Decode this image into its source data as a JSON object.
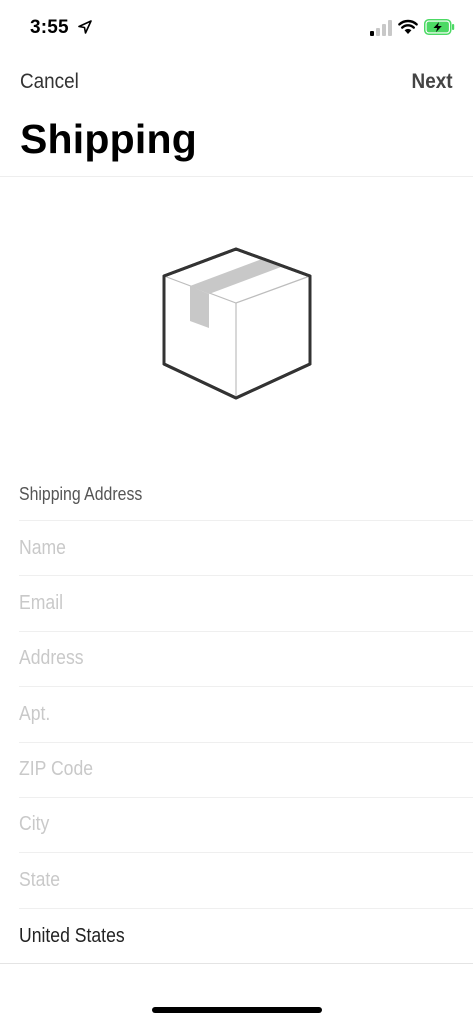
{
  "status_bar": {
    "time": "3:55",
    "icons": [
      "location-arrow-icon",
      "cellular-signal-icon",
      "wifi-icon",
      "battery-charging-icon"
    ],
    "battery_color": "#4cd964"
  },
  "nav": {
    "cancel_label": "Cancel",
    "next_label": "Next"
  },
  "page": {
    "title": "Shipping",
    "illustration": "package-box-icon"
  },
  "shipping_address": {
    "section_header": "Shipping Address",
    "fields": {
      "name": {
        "placeholder": "Name",
        "value": ""
      },
      "email": {
        "placeholder": "Email",
        "value": ""
      },
      "address": {
        "placeholder": "Address",
        "value": ""
      },
      "apt": {
        "placeholder": "Apt.",
        "value": ""
      },
      "zip": {
        "placeholder": "ZIP Code",
        "value": ""
      },
      "city": {
        "placeholder": "City",
        "value": ""
      },
      "state": {
        "placeholder": "State",
        "value": ""
      }
    },
    "country": "United States"
  },
  "colors": {
    "placeholder": "#c9c9c9",
    "divider": "#efefef",
    "box_tape": "#c8c8c8"
  }
}
